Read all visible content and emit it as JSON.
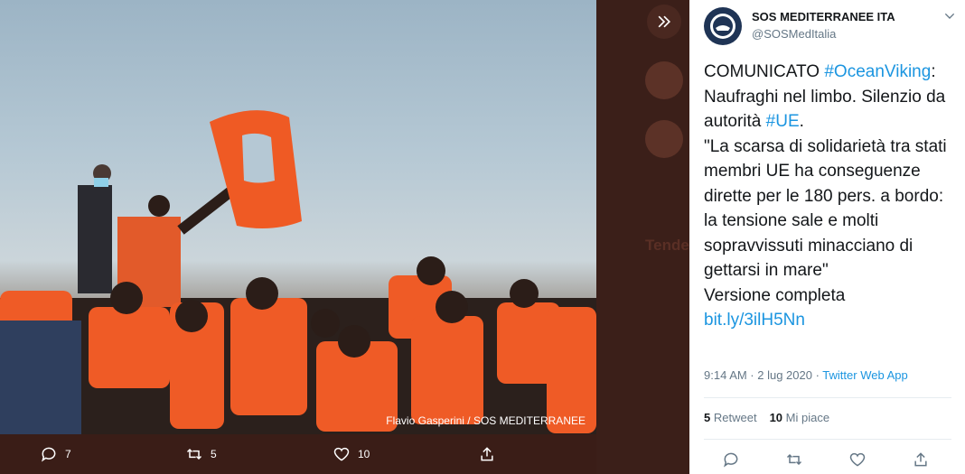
{
  "photo": {
    "credit": "Flavio Gasperini / SOS MEDITERRANEE"
  },
  "photo_actions": {
    "reply_count": "7",
    "retweet_count": "5",
    "like_count": "10"
  },
  "background_ghost": {
    "tweet_author": "SOS MEDITERRANEE ITA",
    "sidebar_heading": "Tende"
  },
  "tweet": {
    "author_name": "SOS MEDITERRANEE ITA",
    "author_handle": "@SOSMedItalia",
    "text_part1": "COMUNICATO ",
    "hashtag1": "#OceanViking",
    "text_part2": ": Naufraghi nel limbo. Silenzio da autorità ",
    "hashtag2": "#UE",
    "text_part3": ".",
    "quote": "\"La scarsa di solidarietà tra stati membri UE ha conseguenze dirette per le 180 pers. a bordo: la tensione sale e molti sopravvissuti minacciano di gettarsi in mare\"",
    "version_label": "Versione completa",
    "link": "bit.ly/3ilH5Nn",
    "timestamp": "9:14 AM · 2 lug 2020 · ",
    "source": "Twitter Web App",
    "retweets_count": "5",
    "retweets_label": "Retweet",
    "likes_count": "10",
    "likes_label": "Mi piace"
  },
  "colors": {
    "link": "#1b95e0",
    "text": "#14171a",
    "muted": "#657786",
    "backdrop": "#3a1d17"
  }
}
